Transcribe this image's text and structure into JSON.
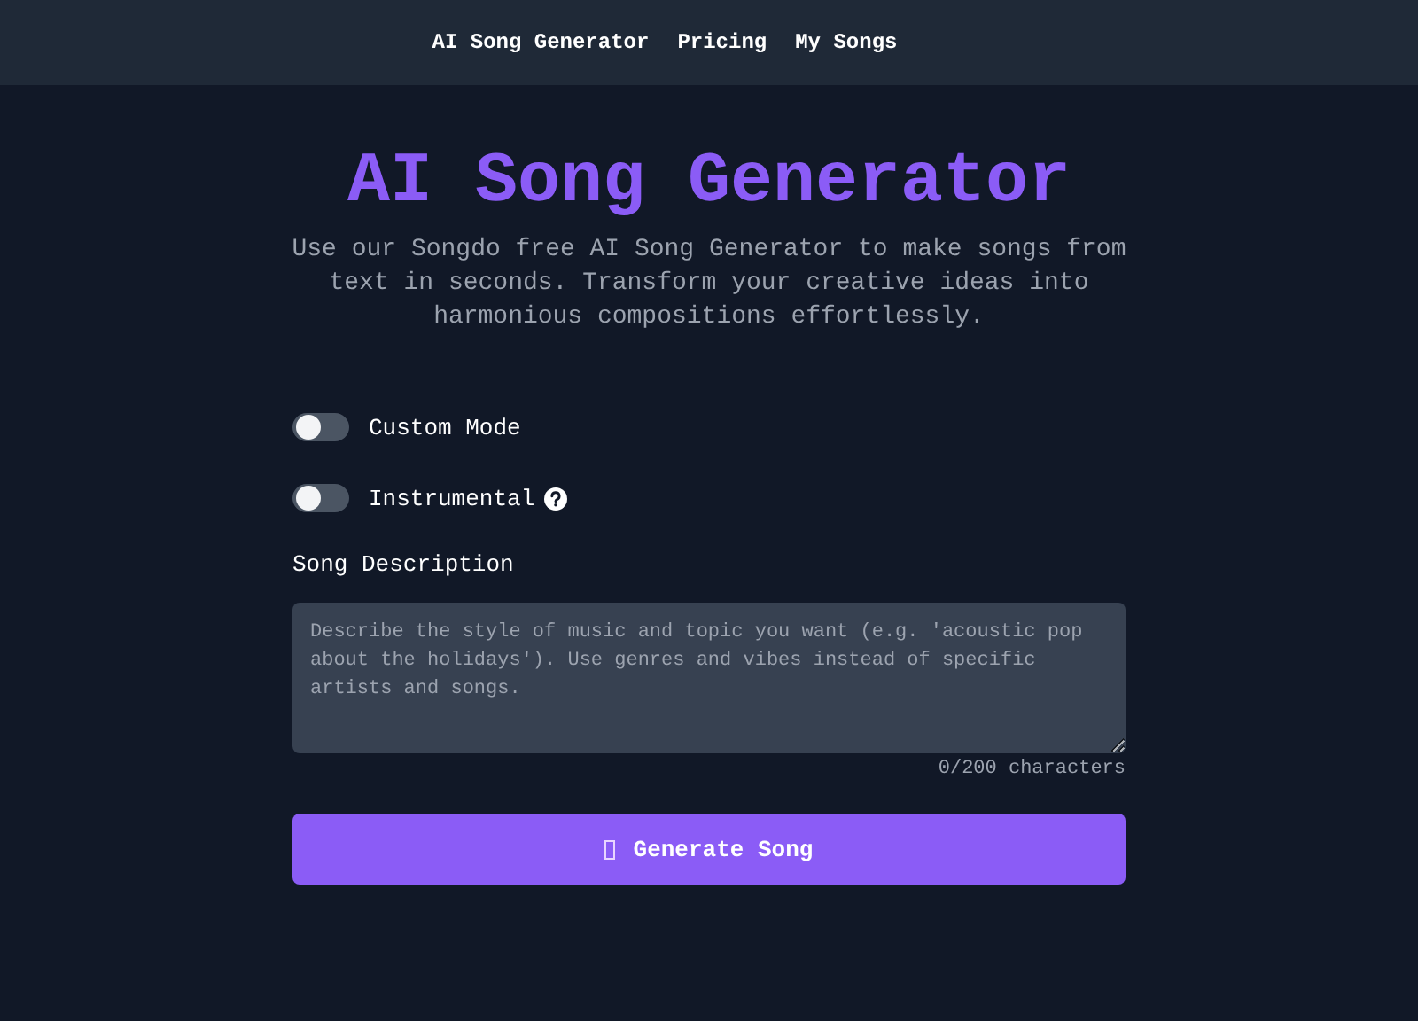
{
  "nav": {
    "links": [
      "AI Song Generator",
      "Pricing",
      "My Songs"
    ]
  },
  "hero": {
    "title": "AI Song Generator",
    "subtitle": "Use our Songdo free AI Song Generator to make songs from text in seconds. Transform your creative ideas into harmonious compositions effortlessly."
  },
  "toggles": [
    {
      "label": "Custom Mode",
      "on": false,
      "help": false
    },
    {
      "label": "Instrumental",
      "on": false,
      "help": true
    }
  ],
  "description": {
    "label": "Song Description",
    "placeholder": "Describe the style of music and topic you want (e.g. 'acoustic pop about the holidays'). Use genres and vibes instead of specific artists and songs.",
    "counter": "0/200 characters"
  },
  "button": {
    "label": "Generate Song"
  }
}
